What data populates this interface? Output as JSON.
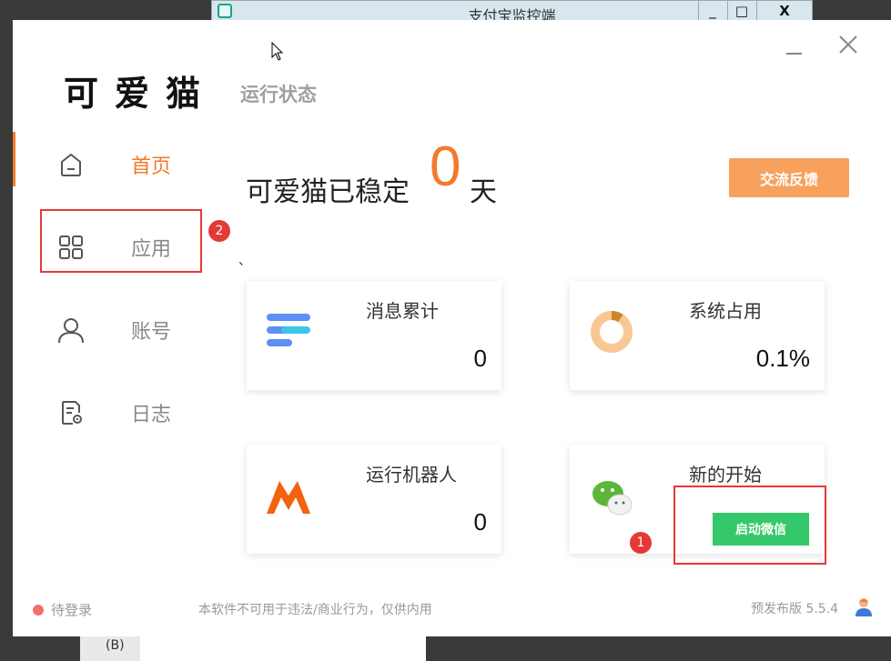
{
  "background_window": {
    "title": "支付宝监控端",
    "buttons": [
      "_",
      "□",
      "X"
    ],
    "bottom_fragment": "(B)"
  },
  "app": {
    "logo_text": "可爱猫",
    "section_title": "运行状态",
    "nav": [
      {
        "label": "首页",
        "icon": "home-icon",
        "active": true
      },
      {
        "label": "应用",
        "icon": "apps-grid-icon",
        "active": false
      },
      {
        "label": "账号",
        "icon": "user-icon",
        "active": false
      },
      {
        "label": "日志",
        "icon": "log-settings-icon",
        "active": false
      }
    ],
    "stable": {
      "prefix": "可爱猫已稳定",
      "days": "0",
      "suffix": "天"
    },
    "tick": "、",
    "feedback_label": "交流反馈",
    "cards": [
      {
        "title": "消息累计",
        "value": "0",
        "icon": "message-lines-icon"
      },
      {
        "title": "系统占用",
        "value": "0.1%",
        "icon": "donut-chart-icon",
        "fraction": 0.001
      },
      {
        "title": "运行机器人",
        "value": "0",
        "icon": "robot-logo-icon"
      },
      {
        "title": "新的开始",
        "button": "启动微信",
        "icon": "wechat-icon"
      }
    ],
    "annotations": [
      "1",
      "2"
    ],
    "footer": {
      "status": "待登录",
      "disclaimer": "本软件不可用于违法/商业行为，仅供内用",
      "version": "预发布版 5.5.4"
    }
  },
  "colors": {
    "accent": "#f4792a",
    "feedback_button": "#f7a15d",
    "start_button": "#35c86a",
    "annotation": "#e53935",
    "status_dot": "#f07070",
    "muted_text": "#999999"
  }
}
